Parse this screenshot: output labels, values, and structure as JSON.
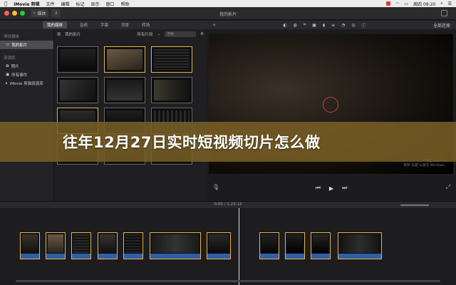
{
  "menubar": {
    "apple_icon": "apple-icon",
    "app_name": "iMovie 剪辑",
    "items": [
      "文件",
      "编辑",
      "标记",
      "显示",
      "窗口",
      "帮助"
    ],
    "clock": "周四 09:20"
  },
  "window": {
    "title": "我的影片",
    "media_button": "媒体"
  },
  "tabs": [
    {
      "label": "我的媒体",
      "active": true
    },
    {
      "label": "音频",
      "active": false
    },
    {
      "label": "字幕",
      "active": false
    },
    {
      "label": "背景",
      "active": false
    },
    {
      "label": "转场",
      "active": false
    }
  ],
  "sidebar": {
    "project_header": "项目媒体",
    "project_item": "我的影片",
    "library_header": "资源库",
    "library_items": [
      "照片",
      "所有事件",
      "iMovie 剪辑资源库"
    ]
  },
  "browser": {
    "title": "我的影片",
    "filter": "所有片段",
    "search_placeholder": "搜索"
  },
  "viewer": {
    "settings": "全部还原",
    "watermark_line1": "激活 Windows",
    "watermark_line2": "转到\"设置\"以激活 Windows。"
  },
  "timeline": {
    "timecode": "0:00 / 1:23:12"
  },
  "banner": {
    "text": "往年12月27日实时短视频切片怎么做"
  },
  "colors": {
    "accent": "#e8b34a",
    "audio": "#2f5fa8",
    "banner": "#7a6026"
  }
}
